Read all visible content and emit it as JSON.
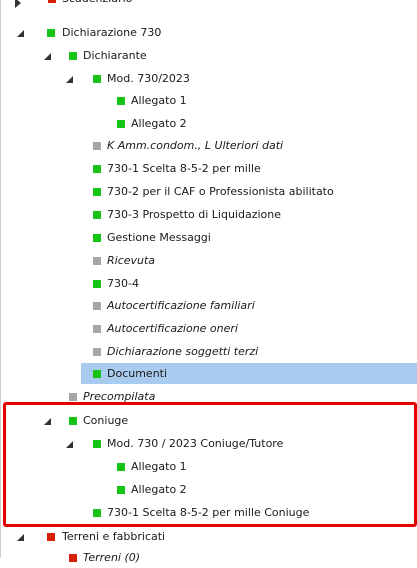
{
  "tree": {
    "top_partial_label": "Scadenziario",
    "dichiarazione_730": "Dichiarazione 730",
    "dichiarante": "Dichiarante",
    "mod_730_2023": "Mod. 730/2023",
    "allegato_1": "Allegato 1",
    "allegato_2": "Allegato 2",
    "k_amm": "K Amm.condom., L Ulteriori dati",
    "scelta_730_1": "730-1 Scelta 8-5-2 per mille",
    "caf_730_2": "730-2 per il CAF o Professionista abilitato",
    "prospetto_730_3": "730-3 Prospetto di Liquidazione",
    "gestione_messaggi": "Gestione Messaggi",
    "ricevuta": "Ricevuta",
    "form_730_4": "730-4",
    "autocert_familiari": "Autocertificazione familiari",
    "autocert_oneri": "Autocertificazione oneri",
    "dich_soggetti_terzi": "Dichiarazione soggetti terzi",
    "documenti": "Documenti",
    "precompilata": "Precompilata",
    "coniuge": "Coniuge",
    "mod_730_coniuge": "Mod. 730 / 2023 Coniuge/Tutore",
    "coniuge_allegato_1": "Allegato 1",
    "coniuge_allegato_2": "Allegato 2",
    "scelta_730_1_coniuge": "730-1 Scelta 8-5-2 per mille Coniuge",
    "terreni_fabbricati": "Terreni e fabbricati",
    "terreni": "Terreni (0)"
  },
  "colors": {
    "green": "#16c416",
    "red": "#d81e05",
    "gray": "#a6a6a6",
    "selection": "#aacbf0",
    "highlight_border": "#e60000"
  }
}
